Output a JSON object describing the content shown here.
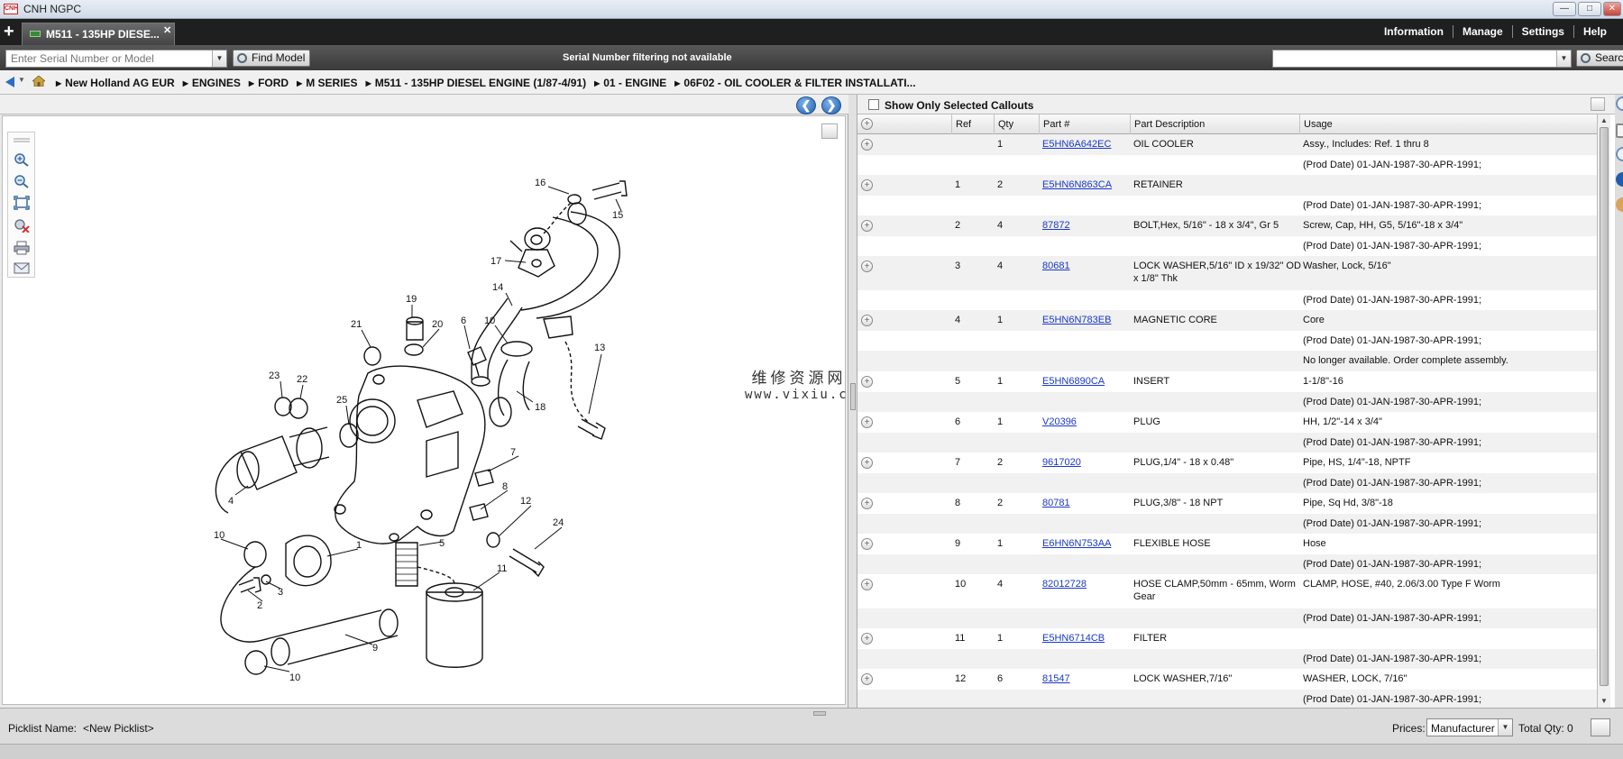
{
  "window": {
    "app_badge": "CNH",
    "title": "CNH NGPC",
    "minimize": "—",
    "maximize": "□",
    "close": "✕"
  },
  "tabs": {
    "new_tab": "+",
    "active_label": "M511 - 135HP DIESE...",
    "close": "✕"
  },
  "top_menu": [
    "Information",
    "Manage",
    "Settings",
    "Help"
  ],
  "search": {
    "serial_placeholder": "Enter Serial Number or Model",
    "find_model_label": "Find Model",
    "serial_status": "Serial Number filtering not available",
    "search_label": "Searc"
  },
  "breadcrumb": [
    "New Holland AG EUR",
    "ENGINES",
    "FORD",
    "M SERIES",
    "M511 - 135HP DIESEL ENGINE (1/87-4/91)",
    "01 - ENGINE",
    "06F02 - OIL COOLER & FILTER INSTALLATI..."
  ],
  "diagram": {
    "callouts": [
      "16",
      "15",
      "17",
      "14",
      "19",
      "21",
      "20",
      "6",
      "10",
      "13",
      "23",
      "22",
      "25",
      "18",
      "7",
      "4",
      "8",
      "12",
      "24",
      "10",
      "1",
      "5",
      "11",
      "3",
      "2",
      "9",
      "10"
    ],
    "watermark_cn": "维修资源网",
    "watermark_url": "www.vixiu.com"
  },
  "parts": {
    "only_selected_label": "Show Only Selected Callouts",
    "columns": {
      "ref": "Ref",
      "qty": "Qty",
      "part": "Part #",
      "desc": "Part Description",
      "usage": "Usage"
    },
    "rows": [
      {
        "ref": "",
        "qty": "1",
        "part": "E5HN6A642EC",
        "desc": "OIL COOLER",
        "usage": "Assy., Includes: Ref. 1 thru 8",
        "usage2": "(Prod Date) 01-JAN-1987-30-APR-1991;"
      },
      {
        "ref": "1",
        "qty": "2",
        "part": "E5HN6N863CA",
        "desc": "RETAINER",
        "usage": "",
        "usage2": "(Prod Date) 01-JAN-1987-30-APR-1991;"
      },
      {
        "ref": "2",
        "qty": "4",
        "part": "87872",
        "desc": "BOLT,Hex, 5/16\" - 18 x 3/4\", Gr 5",
        "usage": "Screw, Cap, HH, G5, 5/16\"-18 x 3/4\"",
        "usage2": "(Prod Date) 01-JAN-1987-30-APR-1991;"
      },
      {
        "ref": "3",
        "qty": "4",
        "part": "80681",
        "desc": "LOCK WASHER,5/16\" ID x 19/32\" OD x 1/8\" Thk",
        "usage": "Washer, Lock,  5/16\"",
        "usage2": "(Prod Date) 01-JAN-1987-30-APR-1991;"
      },
      {
        "ref": "4",
        "qty": "1",
        "part": "E5HN6N783EB",
        "desc": "MAGNETIC CORE",
        "usage": "Core",
        "usage2": "(Prod Date) 01-JAN-1987-30-APR-1991;",
        "usage3": "No longer available. Order complete assembly."
      },
      {
        "ref": "5",
        "qty": "1",
        "part": "E5HN6890CA",
        "desc": "INSERT",
        "usage": "1-1/8\"-16",
        "usage2": "(Prod Date) 01-JAN-1987-30-APR-1991;"
      },
      {
        "ref": "6",
        "qty": "1",
        "part": "V20396",
        "desc": "PLUG",
        "usage": "HH, 1/2\"-14 x 3/4\"",
        "usage2": "(Prod Date) 01-JAN-1987-30-APR-1991;"
      },
      {
        "ref": "7",
        "qty": "2",
        "part": "9617020",
        "desc": "PLUG,1/4\" - 18 x 0.48\"",
        "usage": "Pipe, HS, 1/4\"-18, NPTF",
        "usage2": "(Prod Date) 01-JAN-1987-30-APR-1991;"
      },
      {
        "ref": "8",
        "qty": "2",
        "part": "80781",
        "desc": "PLUG,3/8\" - 18 NPT",
        "usage": "Pipe,  Sq Hd, 3/8\"-18",
        "usage2": "(Prod Date) 01-JAN-1987-30-APR-1991;"
      },
      {
        "ref": "9",
        "qty": "1",
        "part": "E6HN6N753AA",
        "desc": "FLEXIBLE HOSE",
        "usage": "Hose",
        "usage2": "(Prod Date) 01-JAN-1987-30-APR-1991;"
      },
      {
        "ref": "10",
        "qty": "4",
        "part": "82012728",
        "desc": "HOSE CLAMP,50mm - 65mm, Worm Gear",
        "usage": "CLAMP, HOSE,  #40, 2.06/3.00 Type F Worm",
        "usage2": "(Prod Date) 01-JAN-1987-30-APR-1991;"
      },
      {
        "ref": "11",
        "qty": "1",
        "part": "E5HN6714CB",
        "desc": "FILTER",
        "usage": "",
        "usage2": "(Prod Date) 01-JAN-1987-30-APR-1991;"
      },
      {
        "ref": "12",
        "qty": "6",
        "part": "81547",
        "desc": "LOCK WASHER,7/16\"",
        "usage": "WASHER, LOCK,  7/16\"",
        "usage2": "(Prod Date) 01-JAN-1987-30-APR-1991;"
      }
    ]
  },
  "bottom": {
    "picklist_label": "Picklist Name:",
    "picklist_name": "<New Picklist>",
    "prices_label": "Prices:",
    "prices_value": "Manufacturer",
    "total_qty": "Total Qty: 0"
  }
}
